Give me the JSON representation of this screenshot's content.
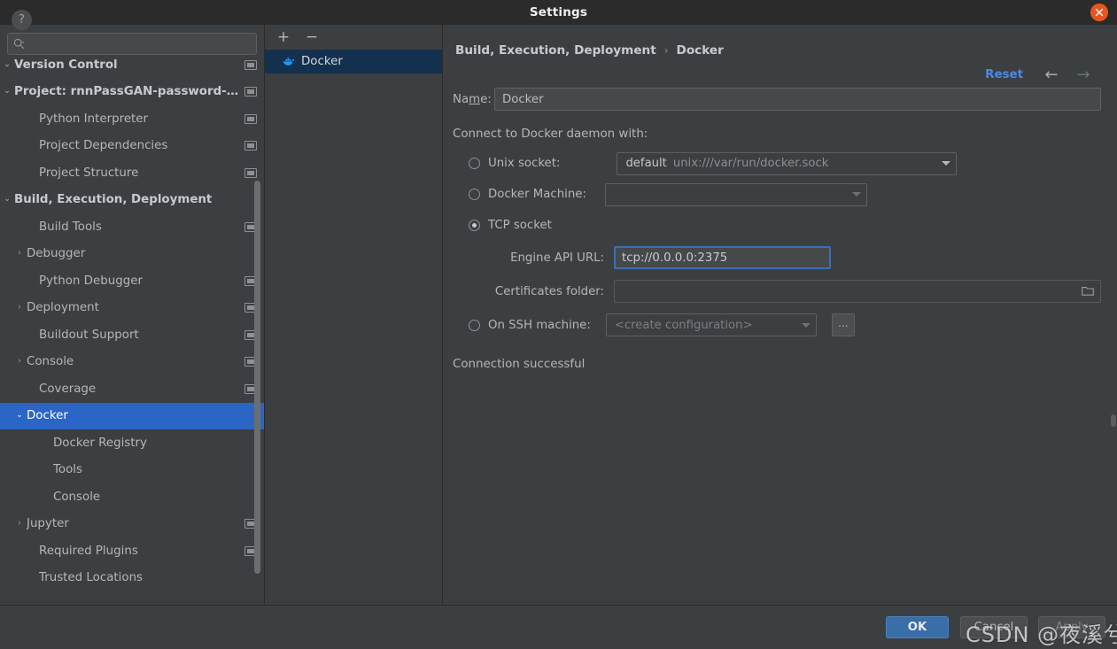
{
  "window": {
    "title": "Settings",
    "close_icon": "close-icon"
  },
  "search": {
    "placeholder": "",
    "value": "",
    "icon": "search-icon"
  },
  "sidebar": {
    "items": [
      {
        "label": "Version Control",
        "arrow": "⌄",
        "bold": true,
        "indent": 14,
        "tag": true,
        "selected": false
      },
      {
        "label": "Project: rnnPassGAN-password-…",
        "arrow": "⌄",
        "bold": true,
        "indent": 14,
        "tag": true,
        "selected": false
      },
      {
        "label": "Python Interpreter",
        "arrow": "",
        "bold": false,
        "indent": 44,
        "tag": true,
        "selected": false
      },
      {
        "label": "Project Dependencies",
        "arrow": "",
        "bold": false,
        "indent": 44,
        "tag": true,
        "selected": false
      },
      {
        "label": "Project Structure",
        "arrow": "",
        "bold": false,
        "indent": 44,
        "tag": true,
        "selected": false
      },
      {
        "label": "Build, Execution, Deployment",
        "arrow": "⌄",
        "bold": true,
        "indent": 14,
        "tag": false,
        "selected": false
      },
      {
        "label": "Build Tools",
        "arrow": "",
        "bold": false,
        "indent": 44,
        "tag": true,
        "selected": false
      },
      {
        "label": "Debugger",
        "arrow": "›",
        "bold": false,
        "indent": 30,
        "tag": false,
        "selected": false
      },
      {
        "label": "Python Debugger",
        "arrow": "",
        "bold": false,
        "indent": 44,
        "tag": true,
        "selected": false
      },
      {
        "label": "Deployment",
        "arrow": "›",
        "bold": false,
        "indent": 30,
        "tag": true,
        "selected": false
      },
      {
        "label": "Buildout Support",
        "arrow": "",
        "bold": false,
        "indent": 44,
        "tag": true,
        "selected": false
      },
      {
        "label": "Console",
        "arrow": "›",
        "bold": false,
        "indent": 30,
        "tag": true,
        "selected": false
      },
      {
        "label": "Coverage",
        "arrow": "",
        "bold": false,
        "indent": 44,
        "tag": true,
        "selected": false
      },
      {
        "label": "Docker",
        "arrow": "⌄",
        "bold": false,
        "indent": 30,
        "tag": false,
        "selected": true
      },
      {
        "label": "Docker Registry",
        "arrow": "",
        "bold": false,
        "indent": 60,
        "tag": false,
        "selected": false
      },
      {
        "label": "Tools",
        "arrow": "",
        "bold": false,
        "indent": 60,
        "tag": false,
        "selected": false
      },
      {
        "label": "Console",
        "arrow": "",
        "bold": false,
        "indent": 60,
        "tag": false,
        "selected": false
      },
      {
        "label": "Jupyter",
        "arrow": "›",
        "bold": false,
        "indent": 30,
        "tag": true,
        "selected": false
      },
      {
        "label": "Required Plugins",
        "arrow": "",
        "bold": false,
        "indent": 44,
        "tag": true,
        "selected": false
      },
      {
        "label": "Trusted Locations",
        "arrow": "",
        "bold": false,
        "indent": 44,
        "tag": false,
        "selected": false
      }
    ]
  },
  "configlist": {
    "add_label": "+",
    "remove_label": "−",
    "entries": [
      {
        "label": "Docker",
        "icon": "docker-whale-icon",
        "selected": true
      }
    ]
  },
  "detail": {
    "breadcrumb": {
      "parent": "Build, Execution, Deployment",
      "separator": "›",
      "current": "Docker"
    },
    "reset_label": "Reset",
    "back_arrow": "←",
    "forward_arrow": "→",
    "name_label": "Name:",
    "name_value": "Docker",
    "section_label": "Connect to Docker daemon with:",
    "unix_socket": {
      "label": "Unix socket:",
      "checked": false,
      "value_strong": "default",
      "value_dim": "unix:///var/run/docker.sock"
    },
    "docker_machine": {
      "label": "Docker Machine:",
      "checked": false,
      "value": ""
    },
    "tcp_socket": {
      "label": "TCP socket",
      "checked": true,
      "api_url_label": "Engine API URL:",
      "api_url_value": "tcp://0.0.0.0:2375",
      "certs_label": "Certificates folder:",
      "certs_value": "",
      "folder_icon": "folder-icon"
    },
    "ssh_machine": {
      "label": "On SSH machine:",
      "checked": false,
      "value": "<create configuration>",
      "browse_label": "..."
    },
    "status": "Connection successful"
  },
  "footer": {
    "help_label": "?",
    "ok_label": "OK",
    "cancel_label": "Cancel",
    "apply_label": "Apply"
  },
  "watermark": {
    "text": "CSDN @夜溪兮"
  },
  "colors": {
    "selection_blue": "#2b65c6",
    "link_blue": "#4d87e0",
    "ok_button": "#3a6ea8",
    "close_orange": "#e8551f",
    "docker_blue": "#2496ed",
    "focus_border": "#3d6fb5"
  }
}
